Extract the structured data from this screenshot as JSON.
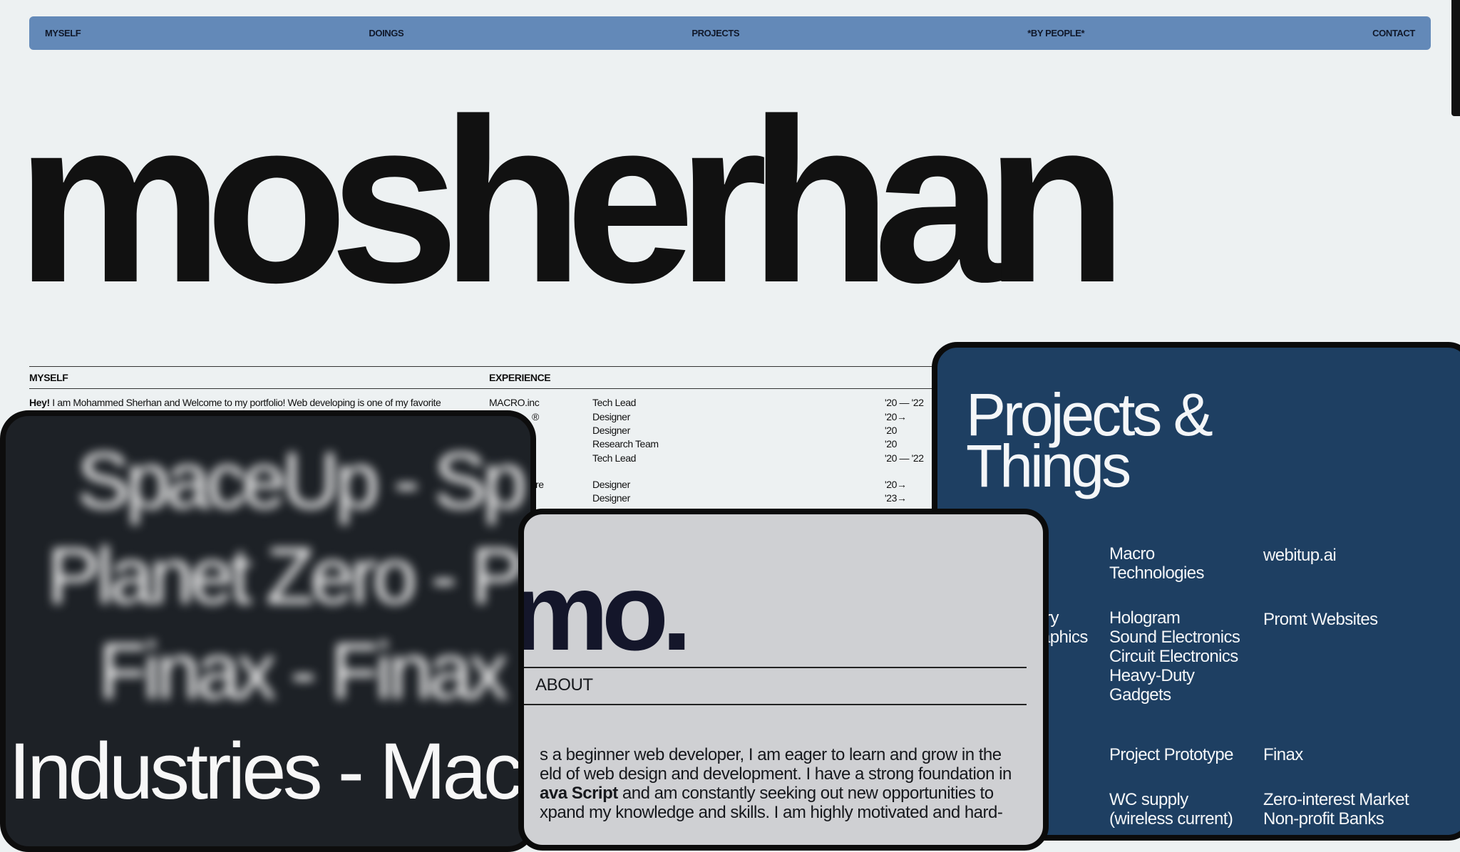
{
  "nav": {
    "items": [
      "MYSELF",
      "DOINGS",
      "PROJECTS",
      "*BY PEOPLE*",
      "CONTACT"
    ]
  },
  "hero": {
    "title": "mosherhan"
  },
  "myself": {
    "heading": "MYSELF",
    "intro_bold": "Hey!",
    "intro_text": " I am Mohammed Sherhan and Welcome to my portfolio! Web developing is one of my favorite"
  },
  "experience": {
    "heading": "EXPERIENCE",
    "rows": [
      {
        "company": "MACRO.inc",
        "role": "Tech Lead",
        "years": "'20 — '22"
      },
      {
        "company": "®",
        "role": "Designer",
        "years": "'20→"
      },
      {
        "company": "",
        "role": "Designer",
        "years": "'20"
      },
      {
        "company": "",
        "role": "Research Team",
        "years": "'20"
      },
      {
        "company": "",
        "role": "Tech Lead",
        "years": "'20 — '22"
      },
      {
        "company": "re",
        "role": "Designer",
        "years": "'20→"
      },
      {
        "company": "",
        "role": "Designer",
        "years": "'23→"
      }
    ]
  },
  "card_dark": {
    "lines": [
      "SpaceUp - Sp",
      "Planet Zero - P",
      "Finax - Finax",
      "Industries - Mac"
    ]
  },
  "card_blue": {
    "title_line1": "Projects &",
    "title_line2": "Things",
    "col1_partial": [
      "try",
      "aphics"
    ],
    "col2": {
      "a": [
        "Macro",
        "Technologies"
      ],
      "b": [
        "Hologram",
        "Sound Electronics",
        "Circuit Electronics",
        "Heavy-Duty",
        "Gadgets"
      ],
      "c": [
        "Project Prototype"
      ],
      "d": [
        "WC supply",
        "(wireless current)"
      ]
    },
    "col3": {
      "a": "webitup.ai",
      "b": "Promt Websites",
      "c": "Finax",
      "d": [
        "Zero-interest Market",
        "Non-profit Banks"
      ]
    }
  },
  "card_grey": {
    "logo": "mo.",
    "about": "ABOUT",
    "para_1": "s a beginner web developer, I am eager to learn and grow in the",
    "para_2": "eld of web design and development. I have a strong foundation in",
    "para_3_bold": "ava Script",
    "para_3_rest": " and am constantly seeking out new opportunities to",
    "para_4": "xpand my knowledge and skills. I am highly motivated and hard-"
  }
}
